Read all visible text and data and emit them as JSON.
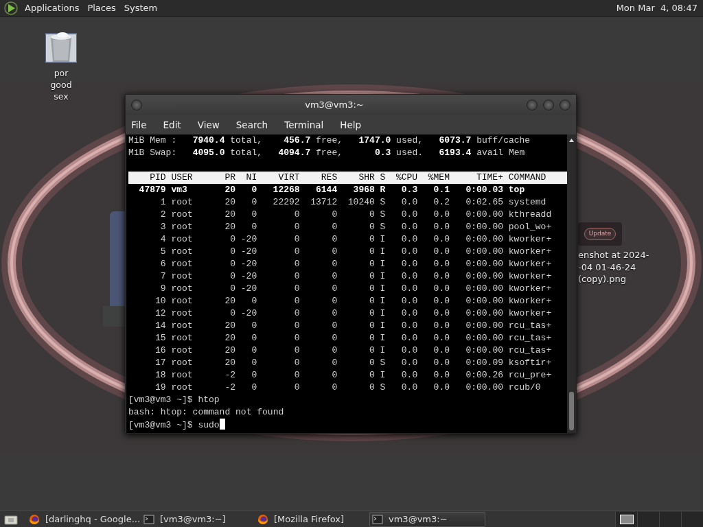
{
  "top_panel": {
    "menus": [
      "Applications",
      "Places",
      "System"
    ],
    "clock": "Mon Mar  4, 08:47"
  },
  "desktop_icons": [
    {
      "kind": "trash",
      "label": "por good sex"
    },
    {
      "thumbnail_button": "Update",
      "label_lines": [
        "enshot at 2024-",
        "-04 01-46-24",
        "(copy).png"
      ]
    }
  ],
  "terminal": {
    "title": "vm3@vm3:~",
    "menu": [
      "File",
      "Edit",
      "View",
      "Search",
      "Terminal",
      "Help"
    ],
    "summary_lines": [
      "MiB Mem :   **7940.4** total,    **456.7** free,   **1747.0** used,   **6073.7** buff/cache",
      "MiB Swap:   **4095.0** total,   **4094.7** free,      **0.3** used.   **6193.4** avail Mem"
    ],
    "process_table": {
      "columns": [
        "PID",
        "USER",
        "PR",
        "NI",
        "VIRT",
        "RES",
        "SHR",
        "S",
        "%CPU",
        "%MEM",
        "TIME+",
        "COMMAND"
      ],
      "rows": [
        {
          "highlighted": true,
          "cells": [
            "47879",
            "vm3",
            "20",
            "0",
            "12268",
            "6144",
            "3968",
            "R",
            "0.3",
            "0.1",
            "0:00.03",
            "top"
          ]
        },
        {
          "highlighted": false,
          "cells": [
            "1",
            "root",
            "20",
            "0",
            "22292",
            "13712",
            "10240",
            "S",
            "0.0",
            "0.2",
            "0:02.65",
            "systemd"
          ]
        },
        {
          "highlighted": false,
          "cells": [
            "2",
            "root",
            "20",
            "0",
            "0",
            "0",
            "0",
            "S",
            "0.0",
            "0.0",
            "0:00.00",
            "kthreadd"
          ]
        },
        {
          "highlighted": false,
          "cells": [
            "3",
            "root",
            "20",
            "0",
            "0",
            "0",
            "0",
            "S",
            "0.0",
            "0.0",
            "0:00.00",
            "pool_wo+"
          ]
        },
        {
          "highlighted": false,
          "cells": [
            "4",
            "root",
            "0",
            "-20",
            "0",
            "0",
            "0",
            "I",
            "0.0",
            "0.0",
            "0:00.00",
            "kworker+"
          ]
        },
        {
          "highlighted": false,
          "cells": [
            "5",
            "root",
            "0",
            "-20",
            "0",
            "0",
            "0",
            "I",
            "0.0",
            "0.0",
            "0:00.00",
            "kworker+"
          ]
        },
        {
          "highlighted": false,
          "cells": [
            "6",
            "root",
            "0",
            "-20",
            "0",
            "0",
            "0",
            "I",
            "0.0",
            "0.0",
            "0:00.00",
            "kworker+"
          ]
        },
        {
          "highlighted": false,
          "cells": [
            "7",
            "root",
            "0",
            "-20",
            "0",
            "0",
            "0",
            "I",
            "0.0",
            "0.0",
            "0:00.00",
            "kworker+"
          ]
        },
        {
          "highlighted": false,
          "cells": [
            "9",
            "root",
            "0",
            "-20",
            "0",
            "0",
            "0",
            "I",
            "0.0",
            "0.0",
            "0:00.00",
            "kworker+"
          ]
        },
        {
          "highlighted": false,
          "cells": [
            "10",
            "root",
            "20",
            "0",
            "0",
            "0",
            "0",
            "I",
            "0.0",
            "0.0",
            "0:00.00",
            "kworker+"
          ]
        },
        {
          "highlighted": false,
          "cells": [
            "12",
            "root",
            "0",
            "-20",
            "0",
            "0",
            "0",
            "I",
            "0.0",
            "0.0",
            "0:00.00",
            "kworker+"
          ]
        },
        {
          "highlighted": false,
          "cells": [
            "14",
            "root",
            "20",
            "0",
            "0",
            "0",
            "0",
            "I",
            "0.0",
            "0.0",
            "0:00.00",
            "rcu_tas+"
          ]
        },
        {
          "highlighted": false,
          "cells": [
            "15",
            "root",
            "20",
            "0",
            "0",
            "0",
            "0",
            "I",
            "0.0",
            "0.0",
            "0:00.00",
            "rcu_tas+"
          ]
        },
        {
          "highlighted": false,
          "cells": [
            "16",
            "root",
            "20",
            "0",
            "0",
            "0",
            "0",
            "I",
            "0.0",
            "0.0",
            "0:00.00",
            "rcu_tas+"
          ]
        },
        {
          "highlighted": false,
          "cells": [
            "17",
            "root",
            "20",
            "0",
            "0",
            "0",
            "0",
            "S",
            "0.0",
            "0.0",
            "0:00.09",
            "ksoftir+"
          ]
        },
        {
          "highlighted": false,
          "cells": [
            "18",
            "root",
            "-2",
            "0",
            "0",
            "0",
            "0",
            "I",
            "0.0",
            "0.0",
            "0:00.26",
            "rcu_pre+"
          ]
        },
        {
          "highlighted": false,
          "cells": [
            "19",
            "root",
            "-2",
            "0",
            "0",
            "0",
            "0",
            "S",
            "0.0",
            "0.0",
            "0:00.00",
            "rcub/0"
          ]
        }
      ]
    },
    "after_lines": [
      "[vm3@vm3 ~]$ htop",
      "bash: htop: command not found"
    ],
    "prompt": "[vm3@vm3 ~]$ sudo"
  },
  "taskbar": {
    "tasks": [
      {
        "kind": "browser",
        "label": "[darlinghq - Google...",
        "selected": false
      },
      {
        "kind": "terminal",
        "label": "[vm3@vm3:~]",
        "selected": false
      },
      {
        "kind": "browser",
        "label": "[Mozilla Firefox]",
        "selected": false
      },
      {
        "kind": "terminal",
        "label": "vm3@vm3:~",
        "selected": true
      }
    ],
    "workspaces": [
      {
        "selected": true
      },
      {
        "selected": false
      },
      {
        "selected": false
      },
      {
        "selected": false
      }
    ]
  }
}
